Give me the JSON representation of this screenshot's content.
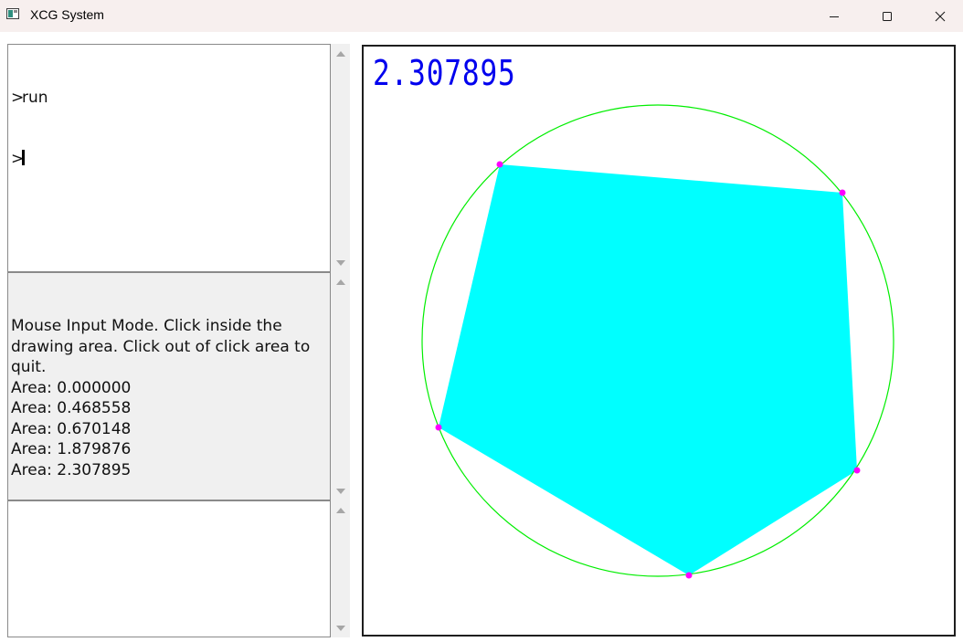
{
  "window": {
    "title": "XCG System",
    "icons": {
      "app": "app-window-icon",
      "minimize": "minimize-icon",
      "maximize": "maximize-icon",
      "close": "close-icon"
    }
  },
  "console": {
    "command_lines": [
      {
        "prompt": ">",
        "text": "run"
      },
      {
        "prompt": ">",
        "text": ""
      }
    ],
    "output": {
      "intro": "Mouse Input Mode. Click inside the drawing area. Click out of click area to quit.",
      "lines": [
        "Area: 0.000000",
        "Area: 0.468558",
        "Area: 0.670148",
        "Area: 1.879876",
        "Area: 2.307895"
      ]
    },
    "log": ""
  },
  "canvas": {
    "area_readout": "2.307895",
    "colors": {
      "polygon_fill": "#00ffff",
      "circle_stroke": "#00ee00",
      "vertex": "#ff00ff",
      "readout": "#0000ee"
    }
  }
}
